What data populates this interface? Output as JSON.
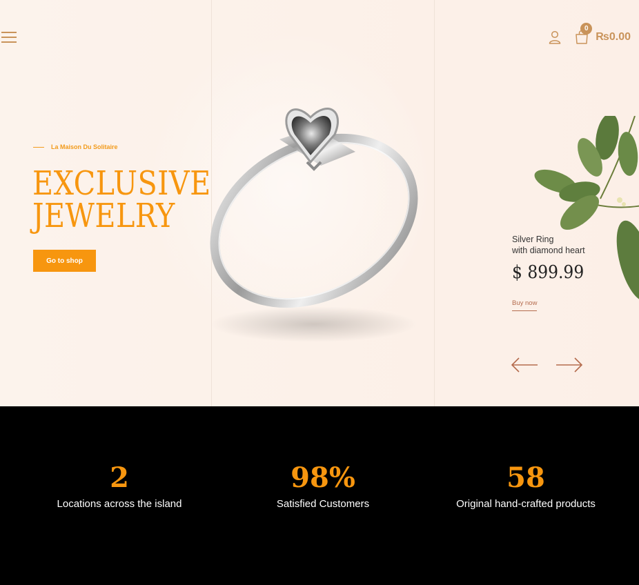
{
  "header": {
    "menu_icon": "hamburger-menu-icon",
    "user_icon": "user-icon",
    "cart_icon": "shopping-bag-icon",
    "cart_count": "0",
    "cart_total": "₨0.00"
  },
  "hero": {
    "eyebrow": "La Maison Du Solitaire",
    "headline_line1": "EXCLUSIVE",
    "headline_line2": "JEWELRY",
    "cta_label": "Go to shop",
    "product": {
      "name_line1": "Silver Ring",
      "name_line2": "with diamond heart",
      "price": "$ 899.99",
      "buy_label": "Buy now"
    },
    "nav": {
      "prev_icon": "arrow-left-icon",
      "next_icon": "arrow-right-icon"
    }
  },
  "stats": [
    {
      "number": "2",
      "label": "Locations across the island"
    },
    {
      "number": "98%",
      "label": "Satisfied Customers"
    },
    {
      "number": "58",
      "label": "Original hand-crafted products"
    }
  ],
  "colors": {
    "accent": "#f7960f",
    "gold": "#c9935a",
    "hero_bg": "#fcf1e9",
    "copper": "#b46b4d",
    "stats_bg": "#000000"
  }
}
